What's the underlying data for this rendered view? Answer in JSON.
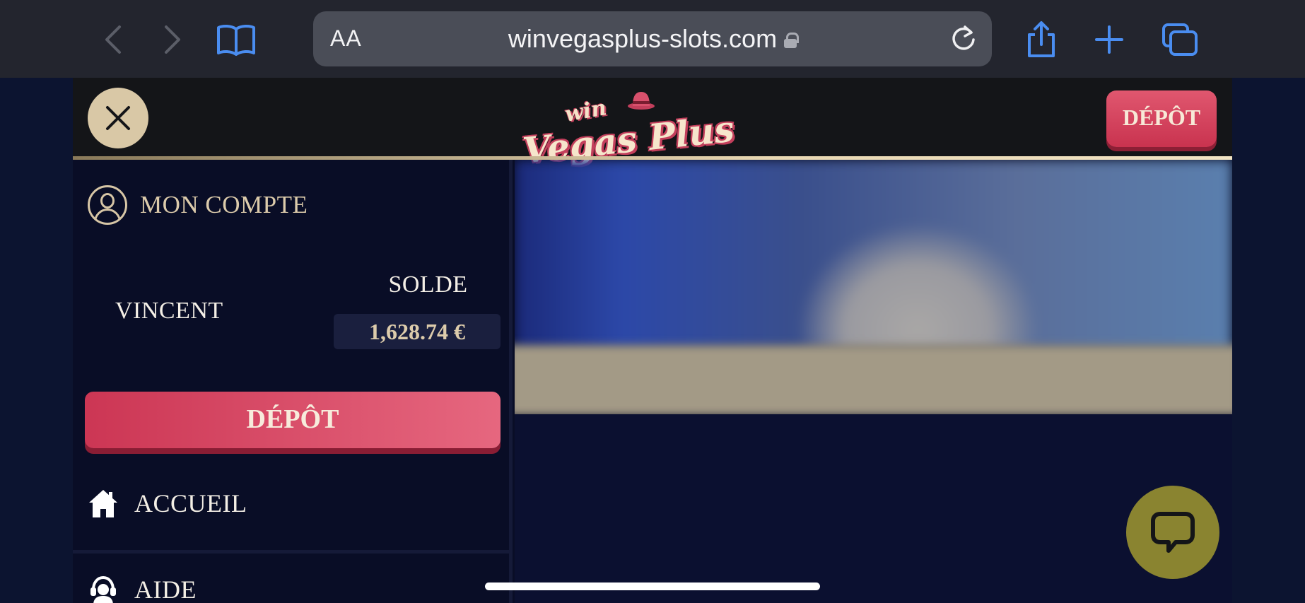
{
  "browser": {
    "reader_label": "AA",
    "url": "winvegasplus-slots.com"
  },
  "header": {
    "logo_win": "win",
    "logo_main": "Vegas Plus",
    "depot_label": "DÉPÔT"
  },
  "menu": {
    "account_label": "MON COMPTE",
    "username": "VINCENT",
    "balance_label": "SOLDE",
    "balance_value": "1,628.74 €",
    "depot_label": "DÉPÔT",
    "items": [
      {
        "label": "ACCUEIL",
        "icon": "home-icon"
      },
      {
        "label": "AIDE",
        "icon": "headset-icon"
      }
    ]
  },
  "colors": {
    "accent_red": "#d23f5e",
    "gold": "#dccbab",
    "background": "#090d26",
    "chat_button": "#8a8430"
  }
}
